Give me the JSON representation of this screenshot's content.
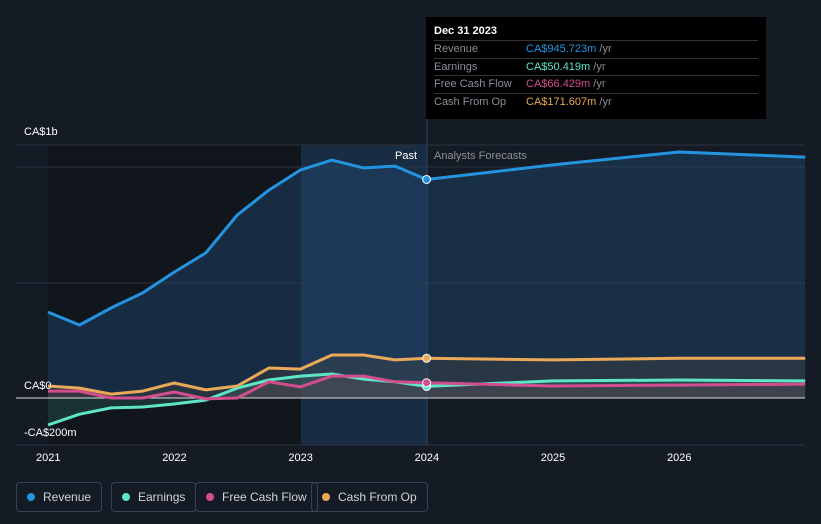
{
  "tooltip": {
    "date": "Dec 31 2023",
    "rows": [
      {
        "label": "Revenue",
        "value": "CA$945.723m",
        "unit": "/yr",
        "color": "#2394df"
      },
      {
        "label": "Earnings",
        "value": "CA$50.419m",
        "unit": "/yr",
        "color": "#5ee4c7"
      },
      {
        "label": "Free Cash Flow",
        "value": "CA$66.429m",
        "unit": "/yr",
        "color": "#d24d8d"
      },
      {
        "label": "Cash From Op",
        "value": "CA$171.607m",
        "unit": "/yr",
        "color": "#e9a958"
      }
    ]
  },
  "chart_data": {
    "type": "line",
    "y_ticks": [
      "CA$1b",
      "CA$0",
      "-CA$200m"
    ],
    "x_ticks": [
      "2021",
      "2022",
      "2023",
      "2024",
      "2025",
      "2026"
    ],
    "ylim": [
      -200,
      1000
    ],
    "past_label": "Past",
    "forecast_label": "Analysts Forecasts",
    "x": [
      2021,
      2021.25,
      2021.5,
      2021.75,
      2022,
      2022.25,
      2022.5,
      2022.75,
      2023,
      2023.25,
      2023.5,
      2023.75,
      2024,
      2025,
      2026,
      2027
    ],
    "series": [
      {
        "name": "Revenue",
        "color": "#2394df",
        "values": [
          372,
          316,
          390,
          455,
          545,
          628,
          792,
          900,
          987,
          1030,
          996,
          1004,
          946,
          1009,
          1065,
          1043
        ]
      },
      {
        "name": "Earnings",
        "color": "#5ee4c7",
        "values": [
          -117,
          -70,
          -43,
          -39,
          -26,
          -9,
          43,
          78,
          95,
          104,
          82,
          70,
          50,
          74,
          78,
          74
        ]
      },
      {
        "name": "Free Cash Flow",
        "color": "#d24d8d",
        "values": [
          30,
          30,
          0,
          0,
          26,
          -4,
          0,
          70,
          48,
          95,
          95,
          70,
          66,
          52,
          56,
          60
        ]
      },
      {
        "name": "Cash From Op",
        "color": "#e9a958",
        "values": [
          52,
          43,
          17,
          30,
          65,
          35,
          52,
          130,
          125,
          186,
          186,
          165,
          172,
          165,
          172,
          172
        ]
      }
    ]
  }
}
